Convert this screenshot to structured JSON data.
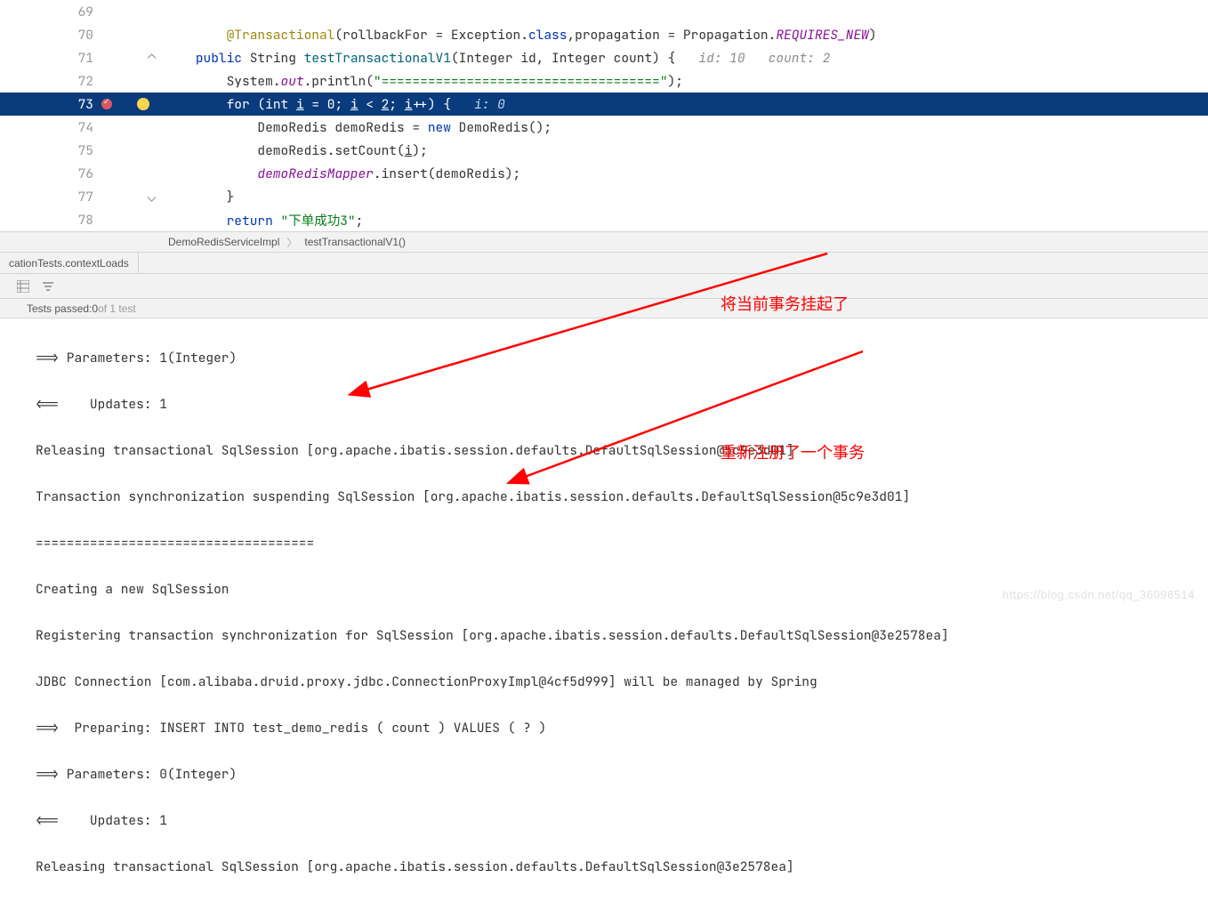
{
  "editor": {
    "lines": {
      "l69": "69",
      "l70": "70",
      "l71": "71",
      "l72": "72",
      "l73": "73",
      "l74": "74",
      "l75": "75",
      "l76": "76",
      "l77": "77",
      "l78": "78"
    },
    "line70": {
      "annotation": "@Transactional",
      "open": "(",
      "p1": "rollbackFor = Exception.",
      "cls": "class",
      "p2": ",propagation = Propagation.",
      "req": "REQUIRES_NEW",
      "close": ")"
    },
    "line71": {
      "public": "public",
      "string_type": " String ",
      "method": "testTransactionalV1",
      "sig_open": "(Integer ",
      "p_id": "id",
      "mid": ", Integer ",
      "p_count": "count",
      "sig_close": ") {",
      "hint": "   id: 10   count: 2"
    },
    "line72": {
      "pre": "        System.",
      "out": "out",
      "mid": ".println(",
      "str": "\"====================================\"",
      "end": ");"
    },
    "line73": {
      "pre": "        ",
      "for": "for",
      "p1": " (",
      "int": "int",
      "p2": " ",
      "i1": "i",
      "eq": " = ",
      "zero": "0",
      "sc1": "; ",
      "i2": "i",
      "lt": " < ",
      "two": "2",
      "sc2": "; ",
      "i3": "i",
      "pp": "++) {",
      "hint": "   i: 0"
    },
    "line74": {
      "pre": "            DemoRedis demoRedis = ",
      "new": "new",
      "rest": " DemoRedis();"
    },
    "line75": {
      "pre": "            demoRedis.setCount(",
      "i": "i",
      "end": ");"
    },
    "line76": {
      "pre": "            ",
      "mapper": "demoRedisMapper",
      "rest": ".insert(demoRedis);"
    },
    "line77": {
      "text": "        }"
    },
    "line78": {
      "pre": "        ",
      "ret": "return",
      "sp": " ",
      "str": "\"下单成功3\"",
      "end": ";"
    }
  },
  "breadcrumb": {
    "item1": "DemoRedisServiceImpl",
    "item2": "testTransactionalV1()"
  },
  "tool_tab": "cationTests.contextLoads",
  "tests_bar": {
    "label": "Tests passed:",
    "count": " 0",
    "of": " of 1 test"
  },
  "console_lines": {
    "l1": "==> Parameters: 1(Integer)",
    "l2": "<==    Updates: 1",
    "l3": "Releasing transactional SqlSession [org.apache.ibatis.session.defaults.DefaultSqlSession@5c9e3d01]",
    "l4": "Transaction synchronization suspending SqlSession [org.apache.ibatis.session.defaults.DefaultSqlSession@5c9e3d01]",
    "l5": "====================================",
    "l6": "Creating a new SqlSession",
    "l7": "Registering transaction synchronization for SqlSession [org.apache.ibatis.session.defaults.DefaultSqlSession@3e2578ea]",
    "l8": "JDBC Connection [com.alibaba.druid.proxy.jdbc.ConnectionProxyImpl@4cf5d999] will be managed by Spring",
    "l9": "==>  Preparing: INSERT INTO test_demo_redis ( count ) VALUES ( ? )",
    "l10": "==> Parameters: 0(Integer)",
    "l11": "<==    Updates: 1",
    "l12": "Releasing transactional SqlSession [org.apache.ibatis.session.defaults.DefaultSqlSession@3e2578ea]"
  },
  "annotations": {
    "a1": "将当前事务挂起了",
    "a2": "重新注册了一个事务"
  },
  "watermark": "https://blog.csdn.net/qq_36098514"
}
